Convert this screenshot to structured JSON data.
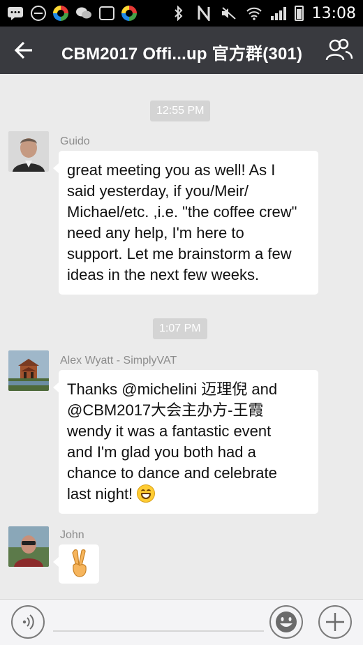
{
  "status_bar": {
    "time": "13:08",
    "icons": [
      "message-icon",
      "block-icon",
      "colorful-app-icon",
      "wechat-icon",
      "gallery-icon",
      "colorful-app-icon",
      "bluetooth-icon",
      "nfc-icon",
      "mute-icon",
      "wifi-icon",
      "signal-icon",
      "battery-icon"
    ]
  },
  "header": {
    "title": "CBM2017 Offi...up 官方群(301)",
    "back_icon": "arrow-left-icon",
    "members_icon": "group-members-icon"
  },
  "messages": [
    {
      "timestamp": "12:55 PM",
      "sender": "Guido",
      "lines": [
        "great meeting you as well! As I",
        "said yesterday, if you/Meir/",
        "Michael/etc. ,i.e. \"the coffee crew\"",
        "need any help, I'm here to",
        "support. Let me brainstorm a few",
        "ideas in the next few weeks."
      ]
    },
    {
      "timestamp": "1:07 PM",
      "sender": "Alex Wyatt - SimplyVAT",
      "lines": [
        "Thanks @michelini 迈理倪 and",
        "@CBM2017大会主办方-王霞",
        "wendy  it was a fantastic event",
        "and I'm glad you both had a",
        "chance to dance and celebrate",
        "last night!"
      ],
      "trailing_emoji": "grinning-face-emoji"
    },
    {
      "sender": "John",
      "emoji": "victory-hand-emoji"
    }
  ],
  "input_bar": {
    "voice_icon": "voice-input-icon",
    "emoji_icon": "emoji-icon",
    "plus_icon": "plus-icon"
  },
  "colors": {
    "title_bar": "#393a3f",
    "chat_background": "#ebebeb",
    "bubble": "#ffffff",
    "timestamp_pill": "#d4d4d4"
  }
}
